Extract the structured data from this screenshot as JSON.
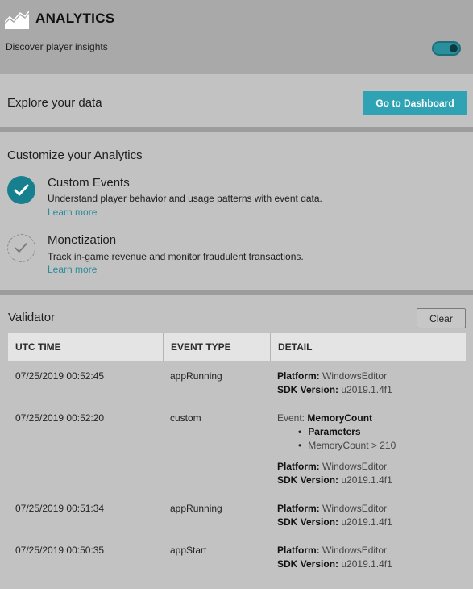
{
  "header": {
    "title": "ANALYTICS",
    "subtitle": "Discover player insights",
    "toggle_state": "on",
    "accent_color": "#2a8f9c"
  },
  "explore": {
    "text": "Explore your data",
    "button_label": "Go to Dashboard"
  },
  "customize": {
    "title": "Customize your Analytics",
    "features": [
      {
        "name": "Custom Events",
        "description": "Understand player behavior and usage patterns with event data.",
        "link": "Learn more",
        "enabled": true,
        "icon": "checkmark-icon"
      },
      {
        "name": "Monetization",
        "description": "Track in-game revenue and monitor fraudulent transactions.",
        "link": "Learn more",
        "enabled": false,
        "icon": "checkmark-icon"
      }
    ]
  },
  "validator": {
    "title": "Validator",
    "clear_label": "Clear",
    "columns": [
      "UTC TIME",
      "EVENT TYPE",
      "DETAIL"
    ],
    "rows": [
      {
        "time": "07/25/2019 00:52:45",
        "type": "appRunning",
        "detail": {
          "platform_label": "Platform:",
          "platform": "WindowsEditor",
          "sdk_label": "SDK Version:",
          "sdk": "u2019.1.4f1"
        }
      },
      {
        "time": "07/25/2019 00:52:20",
        "type": "custom",
        "detail": {
          "event_label": "Event:",
          "event": "MemoryCount",
          "bullets": [
            "Parameters",
            "MemoryCount > 210"
          ],
          "platform_label": "Platform:",
          "platform": "WindowsEditor",
          "sdk_label": "SDK Version:",
          "sdk": "u2019.1.4f1"
        }
      },
      {
        "time": "07/25/2019 00:51:34",
        "type": "appRunning",
        "detail": {
          "platform_label": "Platform:",
          "platform": "WindowsEditor",
          "sdk_label": "SDK Version:",
          "sdk": "u2019.1.4f1"
        }
      },
      {
        "time": "07/25/2019 00:50:35",
        "type": "appStart",
        "detail": {
          "platform_label": "Platform:",
          "platform": "WindowsEditor",
          "sdk_label": "SDK Version:",
          "sdk": "u2019.1.4f1"
        }
      }
    ]
  }
}
